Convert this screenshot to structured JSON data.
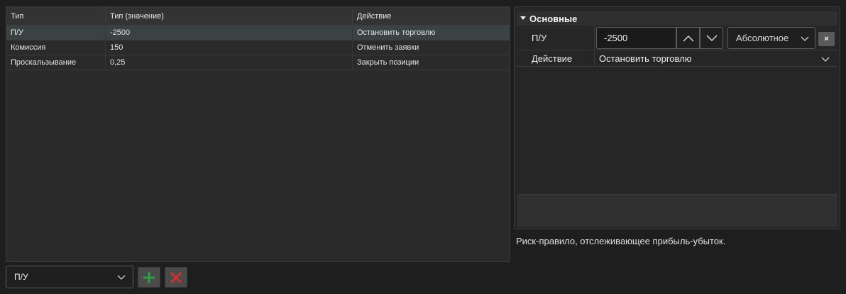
{
  "grid": {
    "columns": [
      "Тип",
      "Тип (значение)",
      "Действие"
    ],
    "rows": [
      {
        "type": "П/У",
        "value": "-2500",
        "action": "Остановить торговлю",
        "selected": true
      },
      {
        "type": "Комиссия",
        "value": "150",
        "action": "Отменить заявки",
        "selected": false
      },
      {
        "type": "Проскальзывание",
        "value": "0,25",
        "action": "Закрыть позиции",
        "selected": false
      }
    ]
  },
  "toolbar": {
    "type_select_value": "П/У",
    "add_icon": "plus-icon",
    "remove_icon": "cross-icon",
    "add_color": "#2f9e44",
    "remove_color": "#d0312d"
  },
  "properties": {
    "category": "Основные",
    "pnl": {
      "label": "П/У",
      "value": "-2500",
      "mode": "Абсолютное",
      "clear_label": "×"
    },
    "action": {
      "label": "Действие",
      "value": "Остановить торговлю"
    }
  },
  "description": "Риск-правило, отслеживающее прибыль-убыток."
}
